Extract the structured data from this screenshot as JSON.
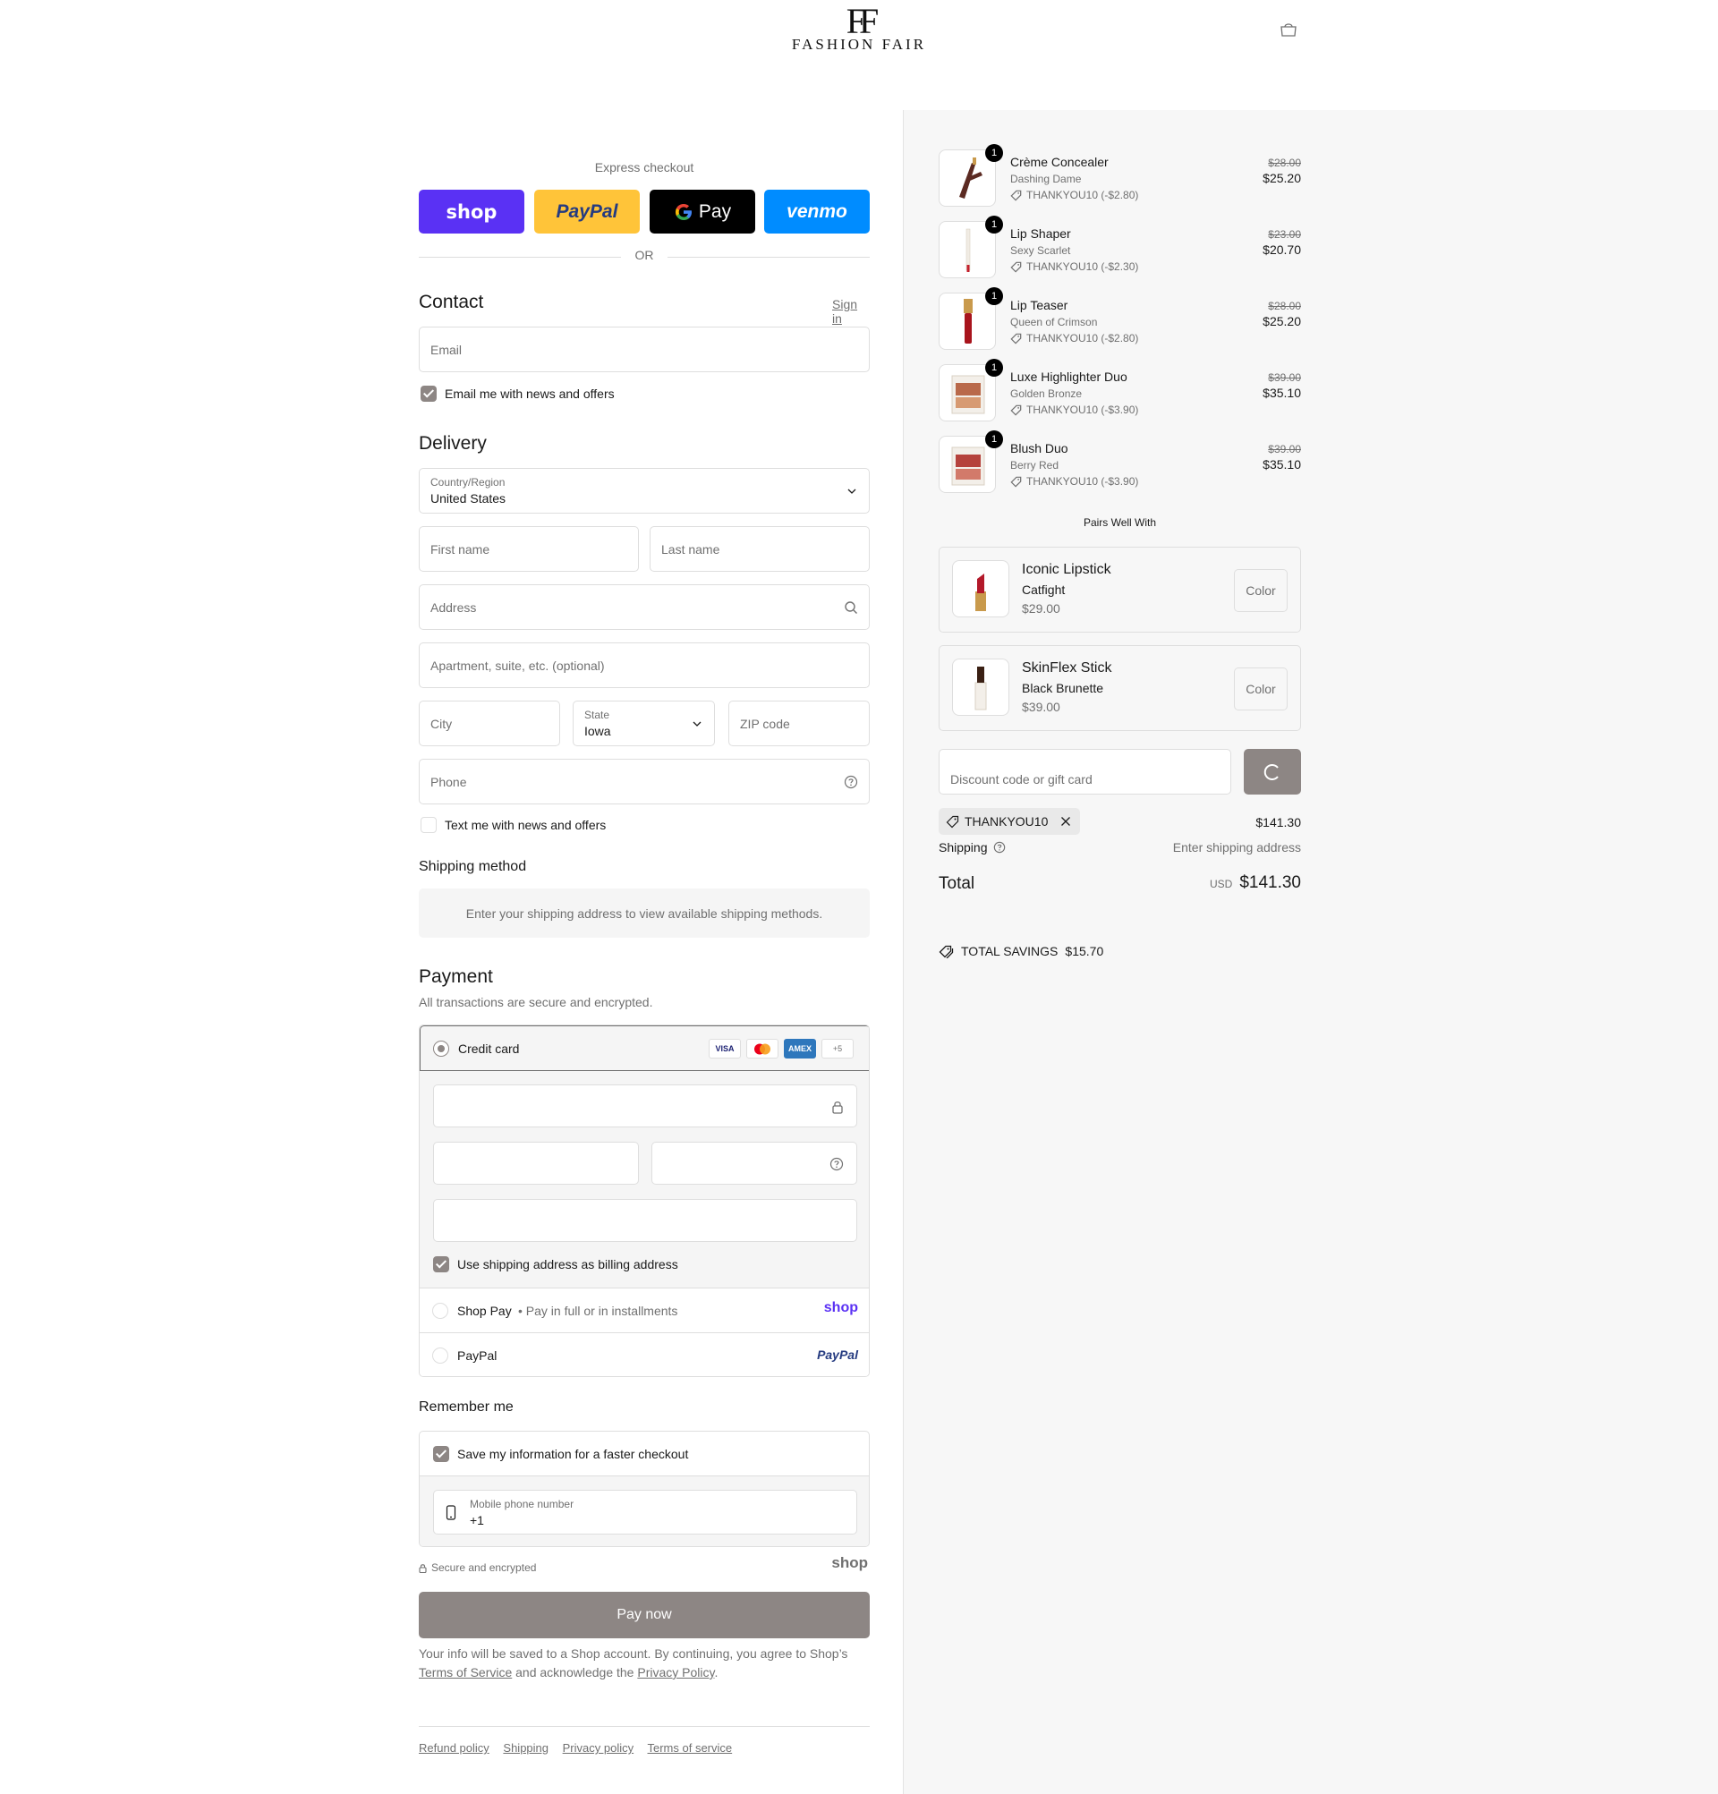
{
  "brand": {
    "monogram": "FF",
    "name": "FASHION FAIR"
  },
  "colors": {
    "accent": "#8d8684",
    "shop_purple": "#5a31f4",
    "paypal_yellow": "#ffc439",
    "venmo_blue": "#008cff",
    "muted": "#707070"
  },
  "express": {
    "title": "Express checkout",
    "buttons": [
      {
        "label": "shop",
        "color": "#5a31f4"
      },
      {
        "label": "PayPal",
        "color": "#ffc439"
      },
      {
        "label": "Pay",
        "color": "#000000"
      },
      {
        "label": "venmo",
        "color": "#008cff"
      }
    ],
    "or": "OR"
  },
  "contact": {
    "title": "Contact",
    "sign_in": "Sign in",
    "email_placeholder": "Email",
    "news_label": "Email me with news and offers",
    "news_checked": true
  },
  "delivery": {
    "title": "Delivery",
    "country_label": "Country/Region",
    "country_value": "United States",
    "first_name": "First name",
    "last_name": "Last name",
    "address": "Address",
    "apartment": "Apartment, suite, etc. (optional)",
    "city": "City",
    "state_label": "State",
    "state_value": "Iowa",
    "zip": "ZIP code",
    "phone": "Phone",
    "text_label": "Text me with news and offers",
    "text_checked": false
  },
  "shipping": {
    "title": "Shipping method",
    "message": "Enter your shipping address to view available shipping methods."
  },
  "payment": {
    "title": "Payment",
    "subtitle": "All transactions are secure and encrypted.",
    "credit_card": "Credit card",
    "card_icons": [
      "VISA",
      "MC",
      "AMEX",
      "+5"
    ],
    "billing_label": "Use shipping address as billing address",
    "billing_checked": true,
    "shop_pay": "Shop Pay",
    "shop_pay_sub": "Pay in full or in installments",
    "shop_logo": "shop",
    "paypal": "PayPal",
    "paypal_logo": "PayPal"
  },
  "remember": {
    "title": "Remember me",
    "save_label": "Save my information for a faster checkout",
    "save_checked": true,
    "phone_label": "Mobile phone number",
    "phone_value": "+1",
    "secure": "Secure and encrypted",
    "shop_logo": "shop"
  },
  "pay_now": "Pay now",
  "legal": {
    "text1": "Your info will be saved to a Shop account. By continuing, you agree to Shop’s",
    "tos": "Terms of Service",
    "text2": "and acknowledge the",
    "privacy": "Privacy Policy",
    "text3": "."
  },
  "footer": [
    "Refund policy",
    "Shipping",
    "Privacy policy",
    "Terms of service"
  ],
  "cart": {
    "items": [
      {
        "name": "Crème Concealer",
        "variant": "Dashing Dame",
        "discount": "THANKYOU10 (-$2.80)",
        "old": "$28.00",
        "price": "$25.20",
        "qty": "1",
        "product_color": "#5b2a22"
      },
      {
        "name": "Lip Shaper",
        "variant": "Sexy Scarlet",
        "discount": "THANKYOU10 (-$2.30)",
        "old": "$23.00",
        "price": "$20.70",
        "qty": "1",
        "product_color": "#c41f2c"
      },
      {
        "name": "Lip Teaser",
        "variant": "Queen of Crimson",
        "discount": "THANKYOU10 (-$2.80)",
        "old": "$28.00",
        "price": "$25.20",
        "qty": "1",
        "product_color": "#a8141c"
      },
      {
        "name": "Luxe Highlighter Duo",
        "variant": "Golden Bronze",
        "discount": "THANKYOU10 (-$3.90)",
        "old": "$39.00",
        "price": "$35.10",
        "qty": "1",
        "product_color": "#b9694a"
      },
      {
        "name": "Blush Duo",
        "variant": "Berry Red",
        "discount": "THANKYOU10 (-$3.90)",
        "old": "$39.00",
        "price": "$35.10",
        "qty": "1",
        "product_color": "#b5423c"
      }
    ],
    "pairs_title": "Pairs Well With",
    "upsells": [
      {
        "name": "Iconic Lipstick",
        "variant": "Catfight",
        "price": "$29.00",
        "button": "Color",
        "product_color": "#b3192a"
      },
      {
        "name": "SkinFlex Stick",
        "variant": "Black Brunette",
        "price": "$39.00",
        "button": "Color",
        "product_color": "#3a2014"
      }
    ],
    "discount_placeholder": "Discount code or gift card",
    "applied_code": "THANKYOU10",
    "subtotal": "$141.30",
    "shipping_label": "Shipping",
    "shipping_value": "Enter shipping address",
    "total_label": "Total",
    "currency": "USD",
    "total": "$141.30",
    "savings_label": "TOTAL SAVINGS",
    "savings": "$15.70"
  }
}
